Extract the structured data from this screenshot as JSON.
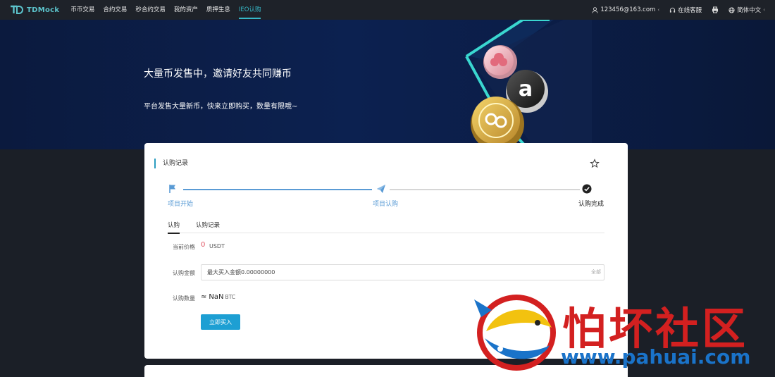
{
  "nav": {
    "logo_text": "TDMock",
    "items": [
      "币币交易",
      "合约交易",
      "秒合约交易",
      "我的资产",
      "质押生息",
      "IEO认购"
    ],
    "active_index": 5,
    "user": "123456@163.com",
    "support": "在线客服",
    "language": "简体中文"
  },
  "hero": {
    "title": "大量币发售中，邀请好友共同赚币",
    "subtitle": "平台发售大量新币，快来立即购买，数量有限哦~"
  },
  "card": {
    "title": "认购记录",
    "steps": [
      {
        "label": "项目开始",
        "state": "done"
      },
      {
        "label": "项目认购",
        "state": "done"
      },
      {
        "label": "认购完成",
        "state": "current"
      }
    ],
    "tabs": [
      "认购",
      "认购记录"
    ],
    "active_tab": 0,
    "price_label": "当前价格",
    "price_value": "0",
    "price_unit": "USDT",
    "amount_label": "认购金额",
    "amount_placeholder": "最大买入金额0.00000000",
    "amount_all": "全部",
    "qty_label": "认购数量",
    "qty_approx": "≈",
    "qty_value": "NaN",
    "qty_unit": "BTC",
    "buy_button": "立即买入"
  },
  "watermark": {
    "cn": "怕坏社区",
    "url": "www.pahuai.com"
  },
  "colors": {
    "accent": "#36b8c8",
    "step_done": "#5a9bd5",
    "button": "#1d9fd3",
    "price": "#e05563"
  }
}
